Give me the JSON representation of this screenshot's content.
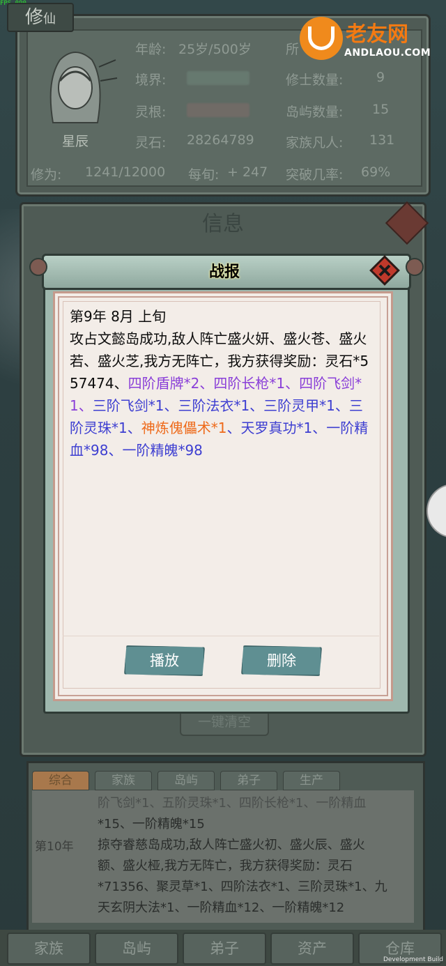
{
  "fps": "FPS-090",
  "header_tab": {
    "main": "修",
    "small": "仙"
  },
  "watermark": {
    "brand": "老友网",
    "domain": "ANDLAOU.COM"
  },
  "character": {
    "name": "星辰",
    "age_label": "年龄:",
    "age_value": "25岁/500岁",
    "realm_label": "境界:",
    "root_label": "灵根:",
    "stone_label": "灵石:",
    "stone_value": "28264789",
    "owner_label": "所",
    "cultivators_label": "修士数量:",
    "cultivators_value": "9",
    "islands_label": "岛屿数量:",
    "islands_value": "15",
    "mortals_label": "家族凡人:",
    "mortals_value": "131",
    "cultivation_label": "修为:",
    "cultivation_value": "1241/12000",
    "per_turn_label": "每旬:",
    "per_turn_value": "+ 247",
    "breakthrough_label": "突破几率:",
    "breakthrough_value": "69%"
  },
  "info_panel": {
    "title": "信息",
    "clear_all": "一键清空"
  },
  "dialog": {
    "title": "战报",
    "date": "第9年 8月 上旬",
    "segments": [
      {
        "text": "攻占文懿岛成功,敌人阵亡盛火妍、盛火苍、盛火若、盛火芝,我方无阵亡，我方获得奖励：灵石*557474、",
        "color": "black"
      },
      {
        "text": "四阶盾牌*2、四阶长枪*1、四阶飞剑*1、",
        "color": "purple"
      },
      {
        "text": "三阶飞剑*1、三阶法衣*1、三阶灵甲*1、三阶灵珠*1、",
        "color": "blue"
      },
      {
        "text": "神炼傀儡术*1",
        "color": "orange"
      },
      {
        "text": "、天罗真功*1、一阶精血*98、一阶精魄*98",
        "color": "blue"
      }
    ],
    "play_button": "播放",
    "delete_button": "删除"
  },
  "log_tabs": [
    "综合",
    "家族",
    "岛屿",
    "弟子",
    "生产"
  ],
  "log": {
    "line1": "阶飞剑*1、五阶灵珠*1、四阶长枪*1、一阶精血",
    "line2": "*15、一阶精魄*15",
    "year": "第10年",
    "line3": "掠夺睿慈岛成功,敌人阵亡盛火初、盛火辰、盛火",
    "line4": "额、盛火桠,我方无阵亡，我方获得奖励：灵石",
    "line5": "*71356、聚灵草*1、四阶法衣*1、三阶灵珠*1、九",
    "line6": "天玄阴大法*1、一阶精血*12、一阶精魄*12"
  },
  "bottom_nav": [
    "家族",
    "岛屿",
    "弟子",
    "资产",
    "仓库"
  ],
  "footer": "Development Build",
  "colors": {
    "purple": "#8a3fd8",
    "blue": "#3d3ed1",
    "orange": "#ee6a1a",
    "button": "#5f8f92"
  }
}
